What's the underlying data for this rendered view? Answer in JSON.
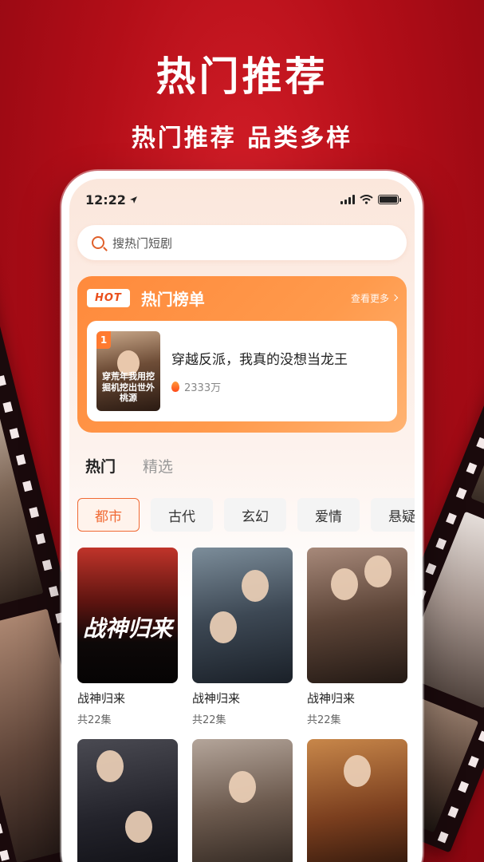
{
  "promo": {
    "headline": "热门推荐",
    "subline": "热门推荐 品类多样"
  },
  "status": {
    "time": "12:22"
  },
  "search": {
    "placeholder": "搜热门短剧"
  },
  "hot_list": {
    "badge": "HOT",
    "title": "热门榜单",
    "more": "查看更多",
    "items": [
      {
        "rank": "1",
        "title": "穿越反派，我真的没想当龙王",
        "heat": "2333万",
        "cover_text": "穿荒年我用挖掘机挖出世外桃源"
      }
    ]
  },
  "tabs": [
    {
      "label": "热门",
      "active": true
    },
    {
      "label": "精选",
      "active": false
    }
  ],
  "categories": [
    {
      "label": "都市",
      "active": true
    },
    {
      "label": "古代",
      "active": false
    },
    {
      "label": "玄幻",
      "active": false
    },
    {
      "label": "爱情",
      "active": false
    },
    {
      "label": "悬疑",
      "active": false
    }
  ],
  "dramas": [
    {
      "title": "战神归来",
      "episodes": "共22集",
      "poster_text": "战神归来"
    },
    {
      "title": "战神归来",
      "episodes": "共22集",
      "poster_text": ""
    },
    {
      "title": "战神归来",
      "episodes": "共22集",
      "poster_text": ""
    },
    {
      "title": "",
      "episodes": "",
      "poster_text": ""
    },
    {
      "title": "",
      "episodes": "",
      "poster_text": ""
    },
    {
      "title": "",
      "episodes": "",
      "poster_text": ""
    }
  ],
  "colors": {
    "background": "#c8161f",
    "accent": "#f06a34",
    "hot_card": "#ff8a3c"
  }
}
